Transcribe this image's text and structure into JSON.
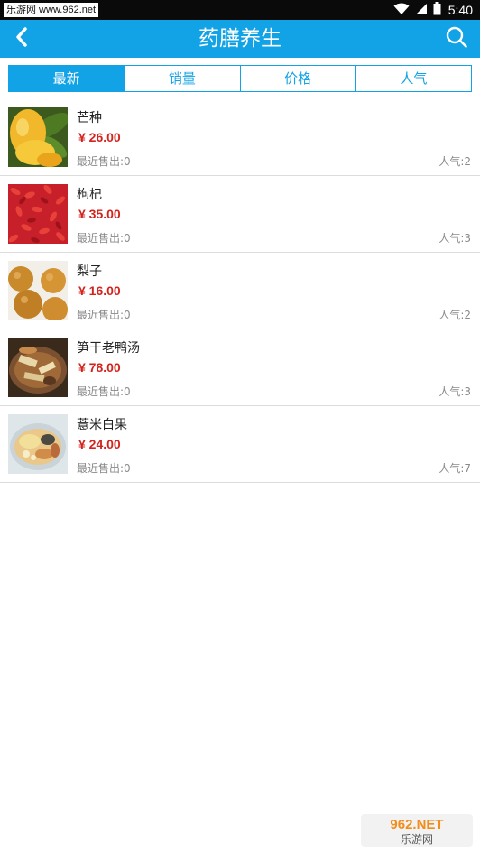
{
  "status_bar": {
    "watermark": "乐游网 www.962.net",
    "time": "5:40"
  },
  "header": {
    "title": "药膳养生",
    "back_icon": "chevron-left-icon",
    "search_icon": "search-icon"
  },
  "tabs": [
    {
      "label": "最新",
      "active": true
    },
    {
      "label": "销量",
      "active": false
    },
    {
      "label": "价格",
      "active": false
    },
    {
      "label": "人气",
      "active": false
    }
  ],
  "products": [
    {
      "name": "芒种",
      "price": "¥ 26.00",
      "sold": "最近售出:0",
      "popularity": "人气:2"
    },
    {
      "name": "枸杞",
      "price": "¥ 35.00",
      "sold": "最近售出:0",
      "popularity": "人气:3"
    },
    {
      "name": "梨子",
      "price": "¥ 16.00",
      "sold": "最近售出:0",
      "popularity": "人气:2"
    },
    {
      "name": "笋干老鸭汤",
      "price": "¥ 78.00",
      "sold": "最近售出:0",
      "popularity": "人气:3"
    },
    {
      "name": "薏米白果",
      "price": "¥ 24.00",
      "sold": "最近售出:0",
      "popularity": "人气:7"
    }
  ],
  "footer_watermark": {
    "logo_text": "962.NET",
    "site_name": "乐游网"
  },
  "colors": {
    "accent": "#12a3e6",
    "price": "#d3231d",
    "muted_text": "#8a8a8a"
  }
}
